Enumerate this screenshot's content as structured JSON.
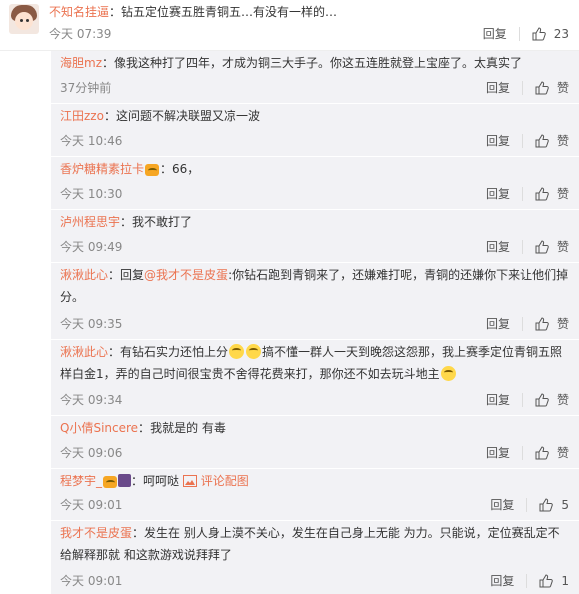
{
  "main_comment": {
    "username": "不知名挂逼",
    "separator": "：",
    "text": "钻五定位赛五胜青铜五…有没有一样的…",
    "time": "今天 07:39",
    "reply_label": "回复",
    "likes": "23"
  },
  "replies": [
    {
      "username": "海胆mz",
      "text": "像我这种打了四年，才成为铜三大手子。你这五连胜就登上宝座了。太真实了",
      "time": "37分钟前",
      "reply_label": "回复",
      "like_label": "赞"
    },
    {
      "username": "江田zzo",
      "text": "这问题不解决联盟又凉一波",
      "time": "今天 10:46",
      "reply_label": "回复",
      "like_label": "赞"
    },
    {
      "username": "香炉糖精素拉卡",
      "text": "66，",
      "time": "今天 10:30",
      "reply_label": "回复",
      "like_label": "赞"
    },
    {
      "username": "泸州程思宇",
      "text": "我不敢打了",
      "time": "今天 09:49",
      "reply_label": "回复",
      "like_label": "赞"
    },
    {
      "username": "湫湫此心",
      "reply_prefix": "回复",
      "mention": "@我才不是皮蛋",
      "text": ":你钻石跑到青铜来了，还嫌难打呢，青铜的还嫌你下来让他们掉分。",
      "time": "今天 09:35",
      "reply_label": "回复",
      "like_label": "赞"
    },
    {
      "username": "湫湫此心",
      "text_a": "有钻石实力还怕上分",
      "text_b": "搞不懂一群人一天到晚怨这怨那，我上赛季定位青铜五照样白金1，弄的自己时间很宝贵不舍得花费来打，那你还不如去玩斗地主",
      "time": "今天 09:34",
      "reply_label": "回复",
      "like_label": "赞"
    },
    {
      "username": "Q小倩Sincere",
      "text": "我就是的 有毒",
      "time": "今天 09:06",
      "reply_label": "回复",
      "like_label": "赞"
    },
    {
      "username": "程梦宇_",
      "text": "呵呵哒",
      "pic_link": "评论配图",
      "time": "今天 09:01",
      "reply_label": "回复",
      "likes": "5"
    },
    {
      "username": "我才不是皮蛋",
      "text": "发生在 别人身上漠不关心，发生在自己身上无能 为力。只能说，定位赛乱定不给解释那就 和这款游戏说拜拜了",
      "time": "今天 09:01",
      "reply_label": "回复",
      "likes": "1"
    }
  ],
  "colors": {
    "username": "#eb7350",
    "sub_bg": "#f2f2f5",
    "time": "#888888"
  }
}
